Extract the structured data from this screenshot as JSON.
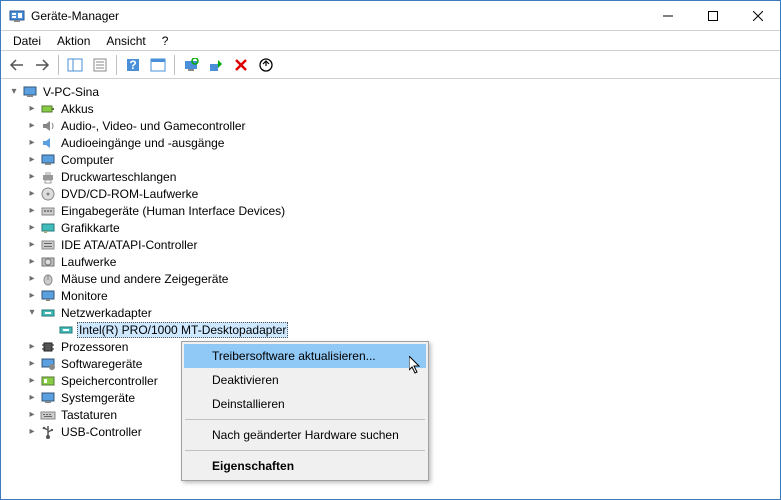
{
  "window": {
    "title": "Geräte-Manager"
  },
  "menu": {
    "file": "Datei",
    "action": "Aktion",
    "view": "Ansicht",
    "help": "?"
  },
  "tree": {
    "root": "V-PC-Sina",
    "akkus": "Akkus",
    "audio": "Audio-, Video- und Gamecontroller",
    "audioio": "Audioeingänge und -ausgänge",
    "computer": "Computer",
    "print": "Druckwarteschlangen",
    "dvd": "DVD/CD-ROM-Laufwerke",
    "hid": "Eingabegeräte (Human Interface Devices)",
    "gfx": "Grafikkarte",
    "ide": "IDE ATA/ATAPI-Controller",
    "disk": "Laufwerke",
    "mouse": "Mäuse und andere Zeigegeräte",
    "monitor": "Monitore",
    "net": "Netzwerkadapter",
    "net_item": "Intel(R) PRO/1000 MT-Desktopadapter",
    "cpu": "Prozessoren",
    "sw": "Softwaregeräte",
    "storage": "Speichercontroller",
    "sys": "Systemgeräte",
    "kbd": "Tastaturen",
    "usb": "USB-Controller"
  },
  "context": {
    "update": "Treibersoftware aktualisieren...",
    "disable": "Deaktivieren",
    "uninstall": "Deinstallieren",
    "scan": "Nach geänderter Hardware suchen",
    "props": "Eigenschaften"
  }
}
